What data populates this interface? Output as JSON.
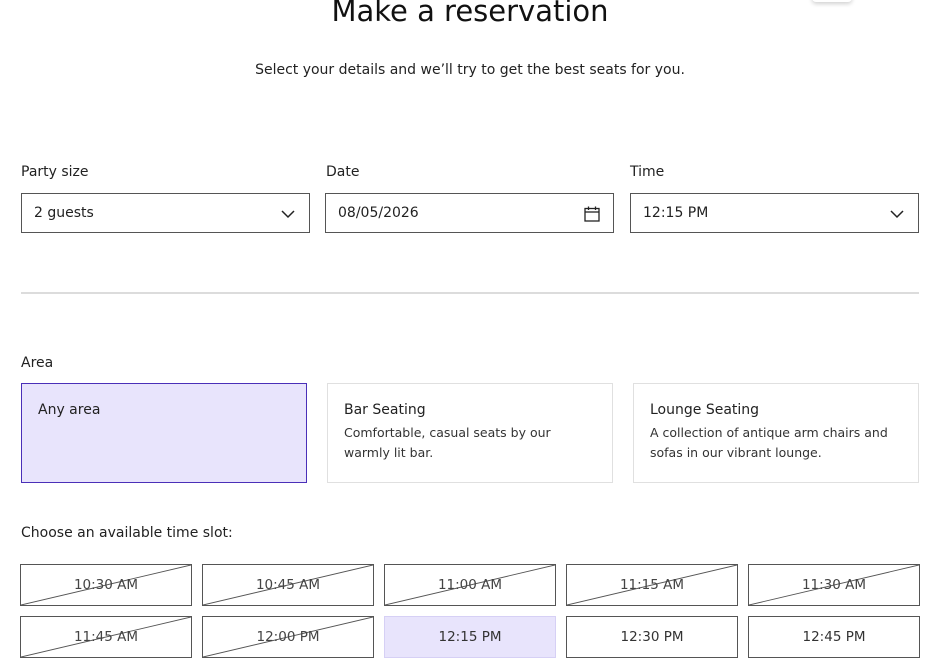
{
  "header": {
    "title": "Make a reservation",
    "subtitle": "Select your details and we’ll try to get the best seats for you."
  },
  "form": {
    "party_size": {
      "label": "Party size",
      "value": "2 guests",
      "icon": "chevron-down-icon"
    },
    "date": {
      "label": "Date",
      "value": "08/05/2026",
      "icon": "calendar-icon"
    },
    "time": {
      "label": "Time",
      "value": "12:15 PM",
      "icon": "chevron-down-icon"
    }
  },
  "area": {
    "label": "Area",
    "options": [
      {
        "name": "Any area",
        "description": "",
        "selected": true
      },
      {
        "name": "Bar Seating",
        "description": "Comfortable, casual seats by our warmly lit bar.",
        "selected": false
      },
      {
        "name": "Lounge Seating",
        "description": "A collection of antique arm chairs and sofas in our vibrant lounge.",
        "selected": false
      }
    ]
  },
  "slots": {
    "label": "Choose an available time slot:",
    "items": [
      {
        "time": "10:30 AM",
        "available": false,
        "selected": false
      },
      {
        "time": "10:45 AM",
        "available": false,
        "selected": false
      },
      {
        "time": "11:00 AM",
        "available": false,
        "selected": false
      },
      {
        "time": "11:15 AM",
        "available": false,
        "selected": false
      },
      {
        "time": "11:30 AM",
        "available": false,
        "selected": false
      },
      {
        "time": "11:45 AM",
        "available": false,
        "selected": false
      },
      {
        "time": "12:00 PM",
        "available": false,
        "selected": false
      },
      {
        "time": "12:15 PM",
        "available": true,
        "selected": true
      },
      {
        "time": "12:30 PM",
        "available": true,
        "selected": false
      },
      {
        "time": "12:45 PM",
        "available": true,
        "selected": false
      }
    ]
  },
  "colors": {
    "selected_bg": "#e8e4fc",
    "selected_border": "#4a2fb8",
    "border": "#555555",
    "divider": "#dcdcdc"
  }
}
